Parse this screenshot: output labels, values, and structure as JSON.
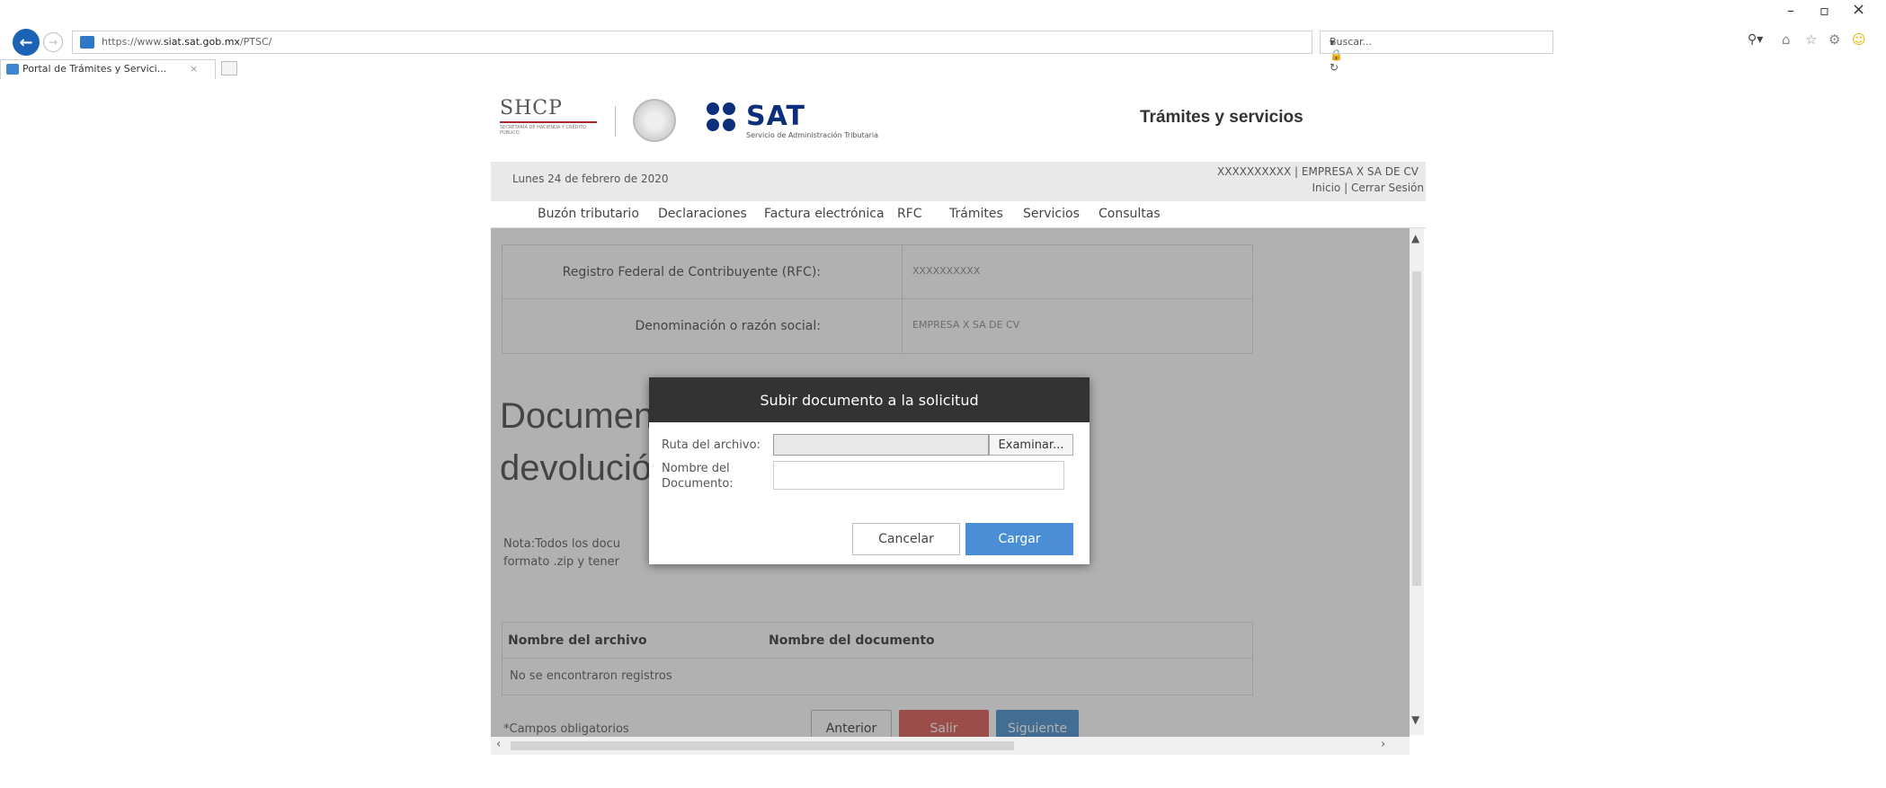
{
  "browser": {
    "url_prefix": "https://www.",
    "url_domain": "siat.sat.gob.mx",
    "url_path": "/PTSC/",
    "search_placeholder": "Buscar...",
    "tab_title": "Portal de Trámites y Servici...",
    "tab_close": "×"
  },
  "header": {
    "shcp": "SHCP",
    "shcp_sub": "SECRETARÍA DE HACIENDA Y CRÉDITO PÚBLICO",
    "sat": "SAT",
    "sat_sub": "Servicio de Administración Tributaria",
    "title": "Trámites y servicios"
  },
  "infobar": {
    "date": "Lunes 24 de febrero de 2020",
    "user": "XXXXXXXXXX | EMPRESA X SA DE CV",
    "links": "Inicio | Cerrar Sesión"
  },
  "menu": [
    "Buzón tributario",
    "Declaraciones",
    "Factura electrónica",
    "RFC",
    "Trámites",
    "Servicios",
    "Consultas"
  ],
  "taxpayer": {
    "rfc_label": "Registro Federal de Contribuyente (RFC):",
    "rfc_value": "XXXXXXXXXX",
    "name_label": "Denominación o razón social:",
    "name_value": "EMPRESA X SA DE CV"
  },
  "section": {
    "title_line1": "Documen",
    "title_line2": "devolució",
    "note_line1": "Nota:Todos los docu",
    "note_line2": "formato .zip y tener"
  },
  "docs_table": {
    "col1": "Nombre del archivo",
    "col2": "Nombre del documento",
    "empty": "No se encontraron registros"
  },
  "footer": {
    "required": "*Campos obligatorios",
    "prev": "Anterior",
    "exit": "Salir",
    "next": "Siguiente"
  },
  "modal": {
    "title": "Subir documento a la solicitud",
    "path_label": "Ruta del archivo:",
    "name_label_1": "Nombre del",
    "name_label_2": "Documento:",
    "browse": "Examinar...",
    "cancel": "Cancelar",
    "upload": "Cargar"
  },
  "colors": {
    "modal_header": "#333333",
    "primary_blue": "#4a8fd6",
    "danger_red": "#d9534f",
    "sat_blue": "#0b2f7a"
  }
}
